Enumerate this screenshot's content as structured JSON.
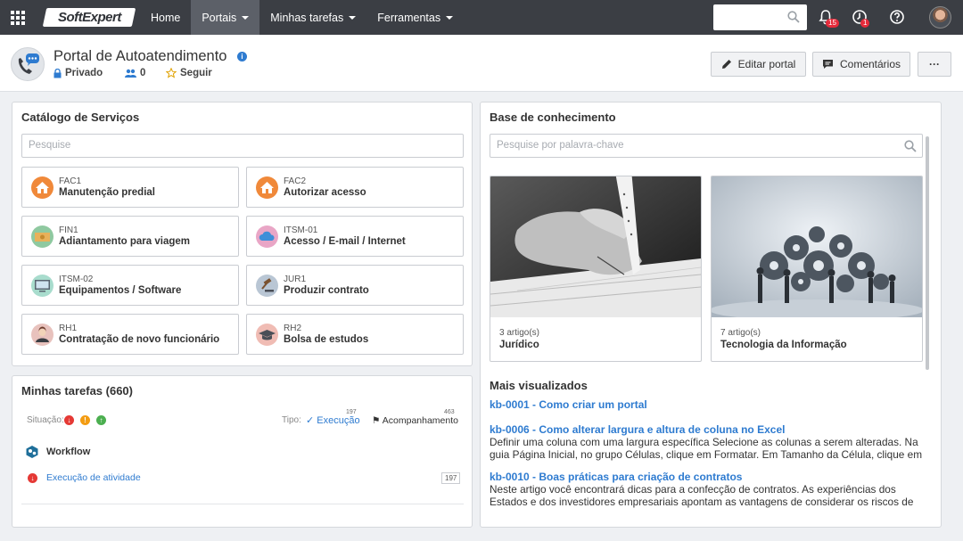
{
  "topbar": {
    "logo": "SoftExpert",
    "nav": [
      {
        "label": "Home"
      },
      {
        "label": "Portais"
      },
      {
        "label": "Minhas tarefas"
      },
      {
        "label": "Ferramentas"
      }
    ],
    "notifications_badge": "15",
    "tasks_badge": "1"
  },
  "header": {
    "title": "Portal de Autoatendimento",
    "privacy": "Privado",
    "followers": "0",
    "follow_label": "Seguir",
    "edit_label": "Editar portal",
    "comments_label": "Comentários",
    "more_label": "···"
  },
  "catalog": {
    "title": "Catálogo de Serviços",
    "search_placeholder": "Pesquise",
    "items": [
      {
        "code": "FAC1",
        "name": "Manutenção predial",
        "color": "#f0893a"
      },
      {
        "code": "FAC2",
        "name": "Autorizar acesso",
        "color": "#f0893a"
      },
      {
        "code": "FIN1",
        "name": "Adiantamento para viagem",
        "color": "#8fc9a0"
      },
      {
        "code": "ITSM-01",
        "name": "Acesso / E-mail / Internet",
        "color": "#e9a6c6"
      },
      {
        "code": "ITSM-02",
        "name": "Equipamentos / Software",
        "color": "#a8dccd"
      },
      {
        "code": "JUR1",
        "name": "Produzir contrato",
        "color": "#b9c6d4"
      },
      {
        "code": "RH1",
        "name": "Contratação de novo funcionário",
        "color": "#e8c2bd"
      },
      {
        "code": "RH2",
        "name": "Bolsa de estudos",
        "color": "#f0bcb4"
      }
    ]
  },
  "tasks": {
    "title": "Minhas tarefas (660)",
    "situacao_label": "Situação:",
    "tipo_label": "Tipo:",
    "execucao_label": "Execução",
    "execucao_count": "197",
    "acompanhamento_label": "Acompanhamento",
    "acompanhamento_count": "463",
    "group_label": "Workflow",
    "activity_label": "Execução de atividade",
    "activity_count": "197"
  },
  "kb": {
    "title": "Base de conhecimento",
    "search_placeholder": "Pesquise por palavra-chave",
    "cards": [
      {
        "count": "3 artigo(s)",
        "name": "Jurídico"
      },
      {
        "count": "7 artigo(s)",
        "name": "Tecnologia da Informação"
      }
    ],
    "most_viewed_title": "Mais visualizados",
    "articles": [
      {
        "title": "kb-0001 - Como criar um portal",
        "desc": ""
      },
      {
        "title": "kb-0006 - Como alterar largura e altura de coluna no Excel",
        "desc": "Definir uma coluna com uma largura específica Selecione as colunas a serem alteradas. Na guia Página Inicial, no grupo Células, clique em Formatar. Em Tamanho da Célula, clique em Largura..."
      },
      {
        "title": "kb-0010 - Boas práticas para criação de contratos",
        "desc": "Neste artigo você encontrará dicas para a confecção de contratos. As experiências dos Estados e dos investidores empresariais apontam as vantagens de considerar os riscos de direitos human..."
      }
    ]
  }
}
